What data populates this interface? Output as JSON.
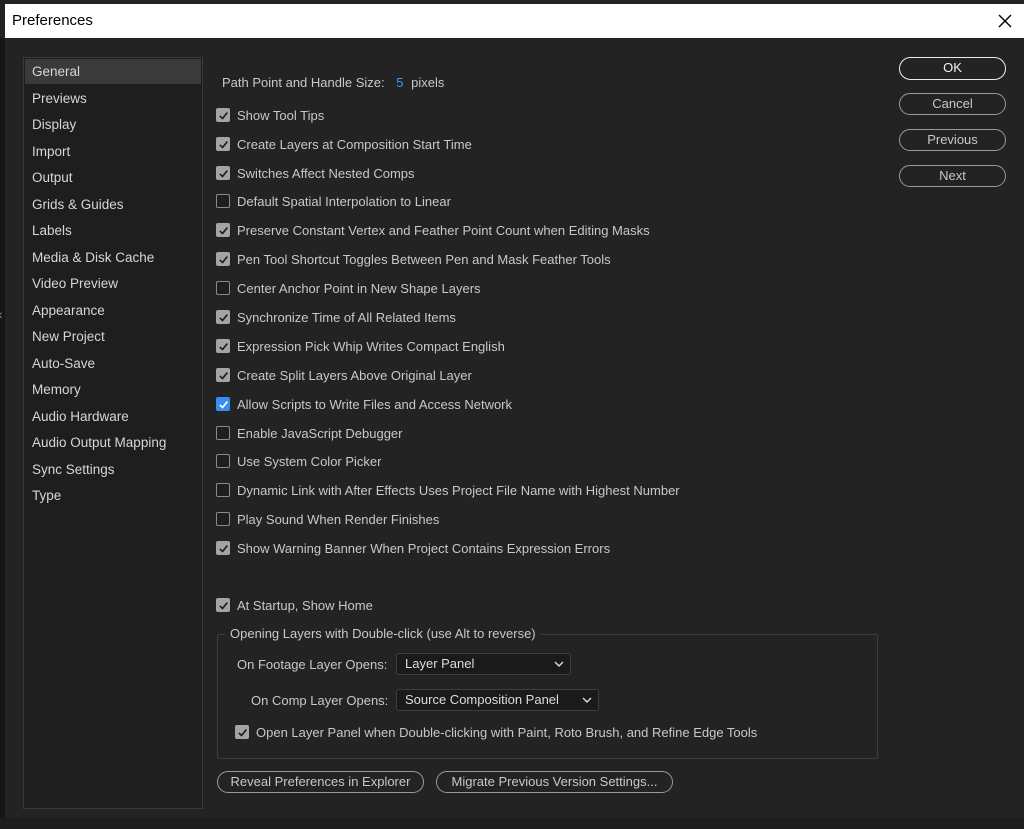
{
  "window": {
    "title": "Preferences"
  },
  "sidebar": {
    "items": [
      {
        "label": "General",
        "active": true
      },
      {
        "label": "Previews"
      },
      {
        "label": "Display"
      },
      {
        "label": "Import"
      },
      {
        "label": "Output"
      },
      {
        "label": "Grids & Guides"
      },
      {
        "label": "Labels"
      },
      {
        "label": "Media & Disk Cache"
      },
      {
        "label": "Video Preview"
      },
      {
        "label": "Appearance"
      },
      {
        "label": "New Project"
      },
      {
        "label": "Auto-Save"
      },
      {
        "label": "Memory"
      },
      {
        "label": "Audio Hardware"
      },
      {
        "label": "Audio Output Mapping"
      },
      {
        "label": "Sync Settings"
      },
      {
        "label": "Type"
      }
    ]
  },
  "general": {
    "path_point_label": "Path Point and Handle Size:",
    "path_point_value": "5",
    "path_point_unit": "pixels",
    "options": [
      {
        "label": "Show Tool Tips",
        "checked": true
      },
      {
        "label": "Create Layers at Composition Start Time",
        "checked": true
      },
      {
        "label": "Switches Affect Nested Comps",
        "checked": true
      },
      {
        "label": "Default Spatial Interpolation to Linear",
        "checked": false
      },
      {
        "label": "Preserve Constant Vertex and Feather Point Count when Editing Masks",
        "checked": true
      },
      {
        "label": "Pen Tool Shortcut Toggles Between Pen and Mask Feather Tools",
        "checked": true
      },
      {
        "label": "Center Anchor Point in New Shape Layers",
        "checked": false
      },
      {
        "label": "Synchronize Time of All Related Items",
        "checked": true
      },
      {
        "label": "Expression Pick Whip Writes Compact English",
        "checked": true
      },
      {
        "label": "Create Split Layers Above Original Layer",
        "checked": true
      },
      {
        "label": "Allow Scripts to Write Files and Access Network",
        "checked": true,
        "accent": true
      },
      {
        "label": "Enable JavaScript Debugger",
        "checked": false
      },
      {
        "label": "Use System Color Picker",
        "checked": false
      },
      {
        "label": "Dynamic Link with After Effects Uses Project File Name with Highest Number",
        "checked": false
      },
      {
        "label": "Play Sound When Render Finishes",
        "checked": false
      },
      {
        "label": "Show Warning Banner When Project Contains Expression Errors",
        "checked": true
      }
    ],
    "startup": {
      "label": "At Startup, Show Home",
      "checked": true
    },
    "group": {
      "legend": "Opening Layers with Double-click (use Alt to reverse)",
      "footage_label": "On Footage Layer Opens:",
      "footage_value": "Layer Panel",
      "comp_label": "On Comp Layer Opens:",
      "comp_value": "Source Composition Panel",
      "paint_label": "Open Layer Panel when Double-clicking with Paint, Roto Brush, and Refine Edge Tools",
      "paint_checked": true
    },
    "reveal_button": "Reveal Preferences in Explorer",
    "migrate_button": "Migrate Previous Version Settings..."
  },
  "buttons": {
    "ok": "OK",
    "cancel": "Cancel",
    "previous": "Previous",
    "next": "Next"
  },
  "colors": {
    "accent": "#378ef0",
    "background": "#232323",
    "checkbox_gray": "#a4a4a4"
  }
}
